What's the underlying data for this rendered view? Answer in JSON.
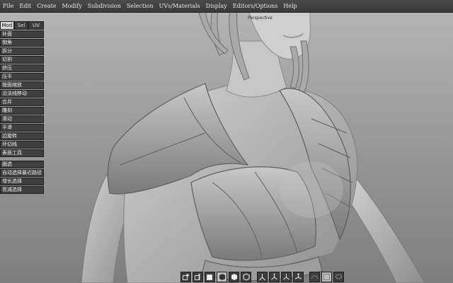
{
  "menu": [
    "File",
    "Edit",
    "Create",
    "Modify",
    "Subdivision",
    "Selection",
    "UVs/Materials",
    "Display",
    "Editors/Options",
    "Help"
  ],
  "viewport": {
    "label": "Perspective"
  },
  "panel": {
    "tabs": [
      "Mod",
      "Sel",
      "UV"
    ],
    "tools_group1": [
      "补面",
      "倒角",
      "拆分",
      "切割",
      "挤压",
      "压平",
      "按面缩放",
      "沿法线移动",
      "合并",
      "雕刻",
      "滑动",
      "平滑",
      "边旋转",
      "环切线",
      "表面工具"
    ],
    "tools_group2": [
      "圈选",
      "自动选择最近路径",
      "增长选择",
      "衰减选择"
    ]
  },
  "toolbar_icons": [
    "vertex-mode-icon",
    "edge-mode-icon",
    "face-mode-icon",
    "object-mode-icon",
    "all-mode-icon",
    "cube-icon",
    "move-gizmo-icon",
    "rotate-gizmo-icon",
    "scale-gizmo-icon",
    "universal-gizmo-icon",
    "dotted-select-icon",
    "marquee-select-icon",
    "lasso-select-icon"
  ],
  "colors": {
    "menubar": "#3f3f3f",
    "panel_button": "#3f3f3f",
    "active_tab": "#d8d8d8"
  }
}
